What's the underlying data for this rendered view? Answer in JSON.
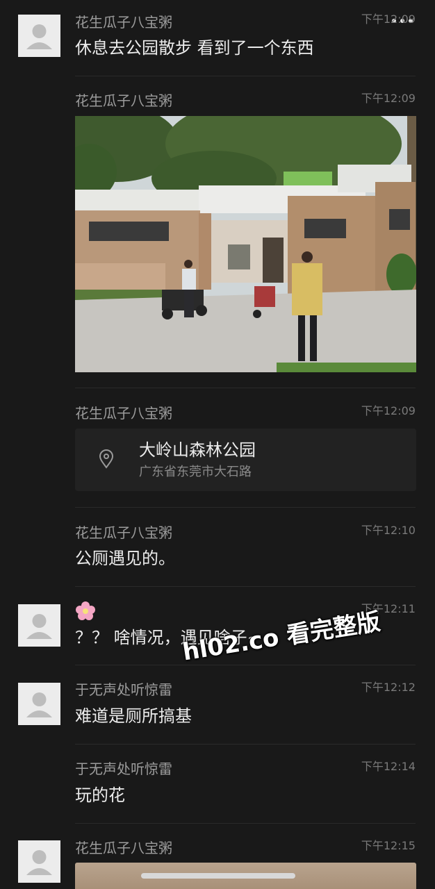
{
  "topbar": {
    "back_icon": "chevron-left-icon",
    "more_icon": "more-icon"
  },
  "messages": [
    {
      "sender": "花生瓜子八宝粥",
      "time": "下午12:09",
      "text": "休息去公园散步 看到了一个东西"
    },
    {
      "sender": "花生瓜子八宝粥",
      "time": "下午12:09",
      "type": "image"
    },
    {
      "sender": "花生瓜子八宝粥",
      "time": "下午12:09",
      "type": "location",
      "location": {
        "title": "大岭山森林公园",
        "address": "广东省东莞市大石路"
      }
    },
    {
      "sender": "花生瓜子八宝粥",
      "time": "下午12:10",
      "text": "公厕遇见的。"
    },
    {
      "sender_emoji": "🌸",
      "time": "下午12:11",
      "text": "？？ 啥情况，遇见啥子~"
    },
    {
      "sender": "于无声处听惊雷",
      "time": "下午12:12",
      "text": "难道是厕所搞基"
    },
    {
      "sender": "于无声处听惊雷",
      "time": "下午12:14",
      "text": "玩的花"
    },
    {
      "sender": "花生瓜子八宝粥",
      "time": "下午12:15",
      "type": "image"
    }
  ],
  "watermark": "hl02.co 看完整版",
  "colors": {
    "background": "#191919",
    "primary_text": "#ececec",
    "secondary_text": "#9c9c9c",
    "time_text": "#7a7a7a",
    "card_bg": "#222222"
  }
}
